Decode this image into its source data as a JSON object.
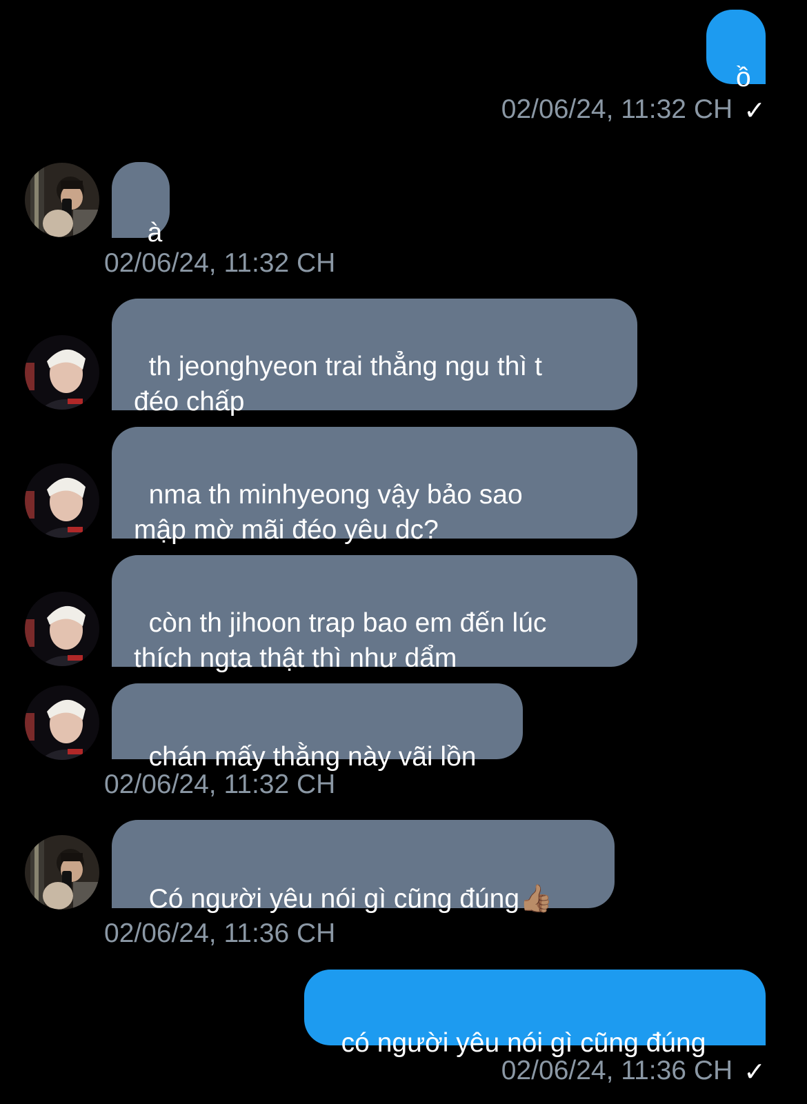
{
  "messages": [
    {
      "text": "ồ",
      "time": "02/06/24, 11:32 CH"
    },
    {
      "text": "à",
      "time": "02/06/24, 11:32 CH"
    },
    {
      "text": "th jeonghyeon trai thẳng ngu thì t\nđéo chấp"
    },
    {
      "text": "nma th minhyeong vậy bảo sao\nmập mờ mãi đéo yêu dc?"
    },
    {
      "text": "còn th jihoon trap bao em đến lúc\nthích ngta thật thì như dẩm"
    },
    {
      "text": "chán mấy thằng này vãi lồn",
      "time": "02/06/24, 11:32 CH"
    },
    {
      "text": "Có người yêu nói gì cũng đúng",
      "emoji": "👍🏽",
      "time": "02/06/24, 11:36 CH"
    },
    {
      "text": "có người yêu nói gì cũng đúng",
      "time": "02/06/24, 11:36 CH"
    }
  ],
  "read_mark": "✓",
  "colors": {
    "background": "#000000",
    "incoming_bubble": "#66768a",
    "outgoing_bubble": "#1d9bf0",
    "timestamp": "#8b98a5"
  }
}
